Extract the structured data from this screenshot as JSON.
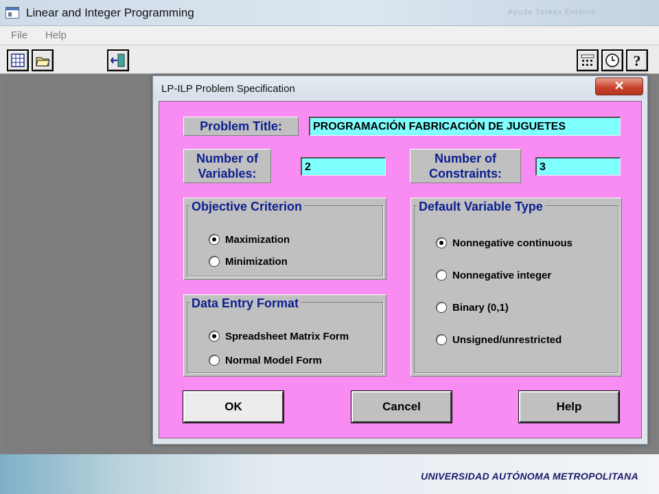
{
  "app": {
    "title": "Linear and Integer Programming",
    "background_tabs_text": "Ayuda Tareas Entorno"
  },
  "menu": {
    "file": "File",
    "help": "Help"
  },
  "toolbar": {
    "new_icon": "grid-icon",
    "open_icon": "open-folder-icon",
    "exit_icon": "exit-door-icon",
    "calculator_icon": "calculator-icon",
    "clock_icon": "clock-icon",
    "help_icon": "question-icon"
  },
  "dialog": {
    "title": "LP-ILP Problem Specification",
    "close_symbol": "✕",
    "problem_title_label": "Problem Title:",
    "problem_title_value": "PROGRAMACIÓN FABRICACIÓN DE JUGUETES",
    "num_variables_label": "Number of Variables:",
    "num_variables_value": "2",
    "num_constraints_label": "Number of Constraints:",
    "num_constraints_value": "3",
    "objective": {
      "title": "Objective Criterion",
      "options": [
        {
          "label": "Maximization",
          "selected": true
        },
        {
          "label": "Minimization",
          "selected": false
        }
      ]
    },
    "data_entry": {
      "title": "Data Entry Format",
      "options": [
        {
          "label": "Spreadsheet Matrix Form",
          "selected": true
        },
        {
          "label": "Normal Model Form",
          "selected": false
        }
      ]
    },
    "variable_type": {
      "title": "Default Variable Type",
      "options": [
        {
          "label": "Nonnegative continuous",
          "selected": true
        },
        {
          "label": "Nonnegative integer",
          "selected": false
        },
        {
          "label": "Binary (0,1)",
          "selected": false
        },
        {
          "label": "Unsigned/unrestricted",
          "selected": false
        }
      ]
    },
    "buttons": {
      "ok": "OK",
      "cancel": "Cancel",
      "help": "Help"
    }
  },
  "footer": {
    "institution": "UNIVERSIDAD AUTÓNOMA METROPOLITANA"
  },
  "colors": {
    "dialog_body": "#f98cf2",
    "field": "#80ffff",
    "label_text": "#0b1f8e"
  }
}
